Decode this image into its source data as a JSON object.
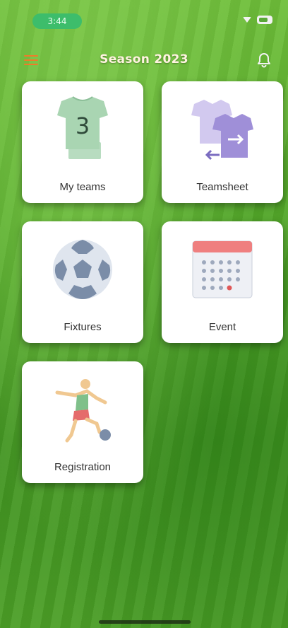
{
  "status_bar": {
    "time": "3:44"
  },
  "header": {
    "title": "Season 2023"
  },
  "tiles": [
    {
      "label": "My teams",
      "icon": "jersey-number-icon",
      "jersey_number": "3"
    },
    {
      "label": "Teamsheet",
      "icon": "jersey-swap-icon"
    },
    {
      "label": "Fixtures",
      "icon": "soccer-ball-icon"
    },
    {
      "label": "Event",
      "icon": "calendar-icon"
    },
    {
      "label": "Registration",
      "icon": "player-kicking-icon"
    }
  ],
  "colors": {
    "accent": "#ef7b2a",
    "title": "#fff3e0",
    "status_pill": "#3dbd6b",
    "card": "#ffffff"
  }
}
